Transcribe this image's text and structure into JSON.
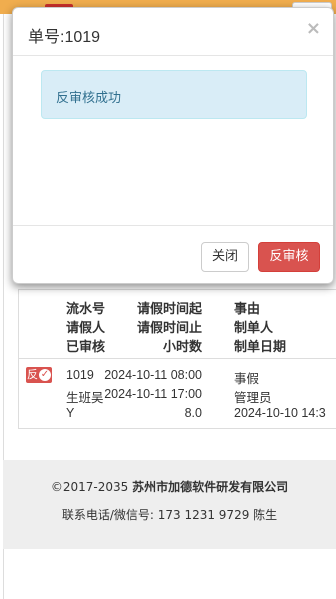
{
  "modal": {
    "title": "单号:1019",
    "close_symbol": "×",
    "message": "反审核成功",
    "buttons": {
      "close": "关闭",
      "unreview": "反审核"
    }
  },
  "table": {
    "headers": {
      "col1": [
        "流水号",
        "请假人",
        "已审核"
      ],
      "col2": [
        "请假时间起",
        "请假时间止",
        "小时数"
      ],
      "col3": [
        "事由",
        "制单人",
        "制单日期"
      ]
    },
    "row": {
      "badge": "反",
      "col1": [
        "1019",
        "生班吴",
        "Y"
      ],
      "col2": [
        "2024-10-11 08:00",
        "2024-10-11 17:00",
        "8.0"
      ],
      "col3": [
        "事假",
        "管理员",
        "2024-10-10 14:3"
      ]
    }
  },
  "footer": {
    "copyright_prefix": "©2017-2035 ",
    "company": "苏州市加德软件研发有限公司",
    "contact": "联系电话/微信号: 173 1231 9729 陈生"
  },
  "colors": {
    "danger": "#d9534f",
    "info_bg": "#d9edf7",
    "info_text": "#31708f",
    "top_strip": "#f0ad4e"
  }
}
